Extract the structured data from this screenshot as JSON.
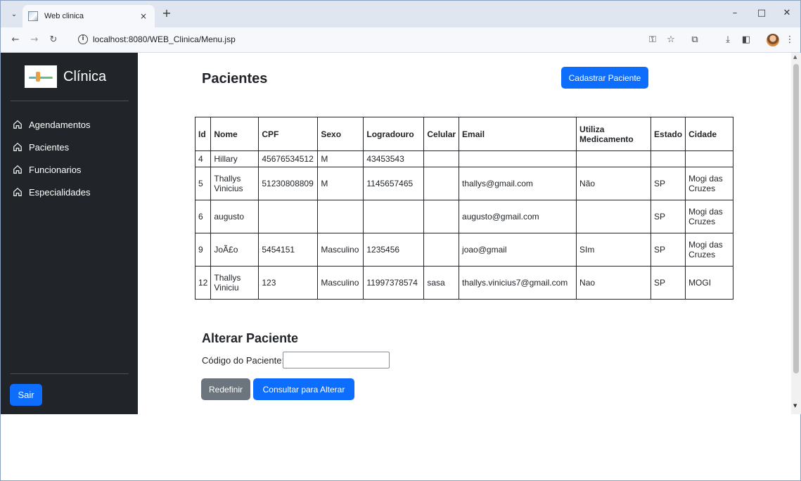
{
  "browser": {
    "tab_title": "Web clinica",
    "tab_close": "×",
    "new_tab": "+",
    "url": "localhost:8080/WEB_Clinica/Menu.jsp",
    "window_controls": {
      "minimize": "–",
      "maximize": "□",
      "close": "✕"
    },
    "icons": [
      "key-icon",
      "star-icon",
      "extensions-icon",
      "download-icon",
      "sidebar-icon",
      "profile-avatar",
      "more-icon"
    ]
  },
  "sidebar": {
    "brand": "Clínica",
    "items": [
      {
        "label": "Agendamentos",
        "icon": "home-icon"
      },
      {
        "label": "Pacientes",
        "icon": "home-icon"
      },
      {
        "label": "Funcionarios",
        "icon": "home-icon"
      },
      {
        "label": "Especialidades",
        "icon": "home-icon"
      }
    ],
    "logout_label": "Sair"
  },
  "main": {
    "title": "Pacientes",
    "add_button": "Cadastrar Paciente",
    "table": {
      "headers": [
        "Id",
        "Nome",
        "CPF",
        "Sexo",
        "Logradouro",
        "Celular",
        "Email",
        "Utiliza Medicamento",
        "Estado",
        "Cidade"
      ],
      "rows": [
        [
          "4",
          "Hillary",
          "45676534512",
          "M",
          "43453543",
          "",
          "",
          "",
          "",
          ""
        ],
        [
          "5",
          "Thallys Vinicius",
          "51230808809",
          "M",
          "1145657465",
          "",
          "thallys@gmail.com",
          "Não",
          "SP",
          "Mogi das Cruzes"
        ],
        [
          "6",
          "augusto",
          "",
          "",
          "",
          "",
          "augusto@gmail.com",
          "",
          "SP",
          "Mogi das Cruzes"
        ],
        [
          "9",
          "JoÃ£o",
          "5454151",
          "Masculino",
          "1235456",
          "",
          "joao@gmail",
          "SIm",
          "SP",
          "Mogi das Cruzes"
        ],
        [
          "12",
          "Thallys Viniciu",
          "123",
          "Masculino",
          "11997378574",
          "sasa",
          "thallys.vinicius7@gmail.com",
          "Nao",
          "SP",
          "MOGI"
        ]
      ]
    }
  },
  "edit_form": {
    "title": "Alterar Paciente",
    "code_label": "Código do Paciente:",
    "code_value": "",
    "reset_button": "Redefinir",
    "consult_button": "Consultar para Alterar"
  },
  "colors": {
    "sidebar_bg": "#212529",
    "primary": "#0d6efd",
    "secondary": "#6c757d",
    "tabbar_bg": "#dfe6f0"
  }
}
